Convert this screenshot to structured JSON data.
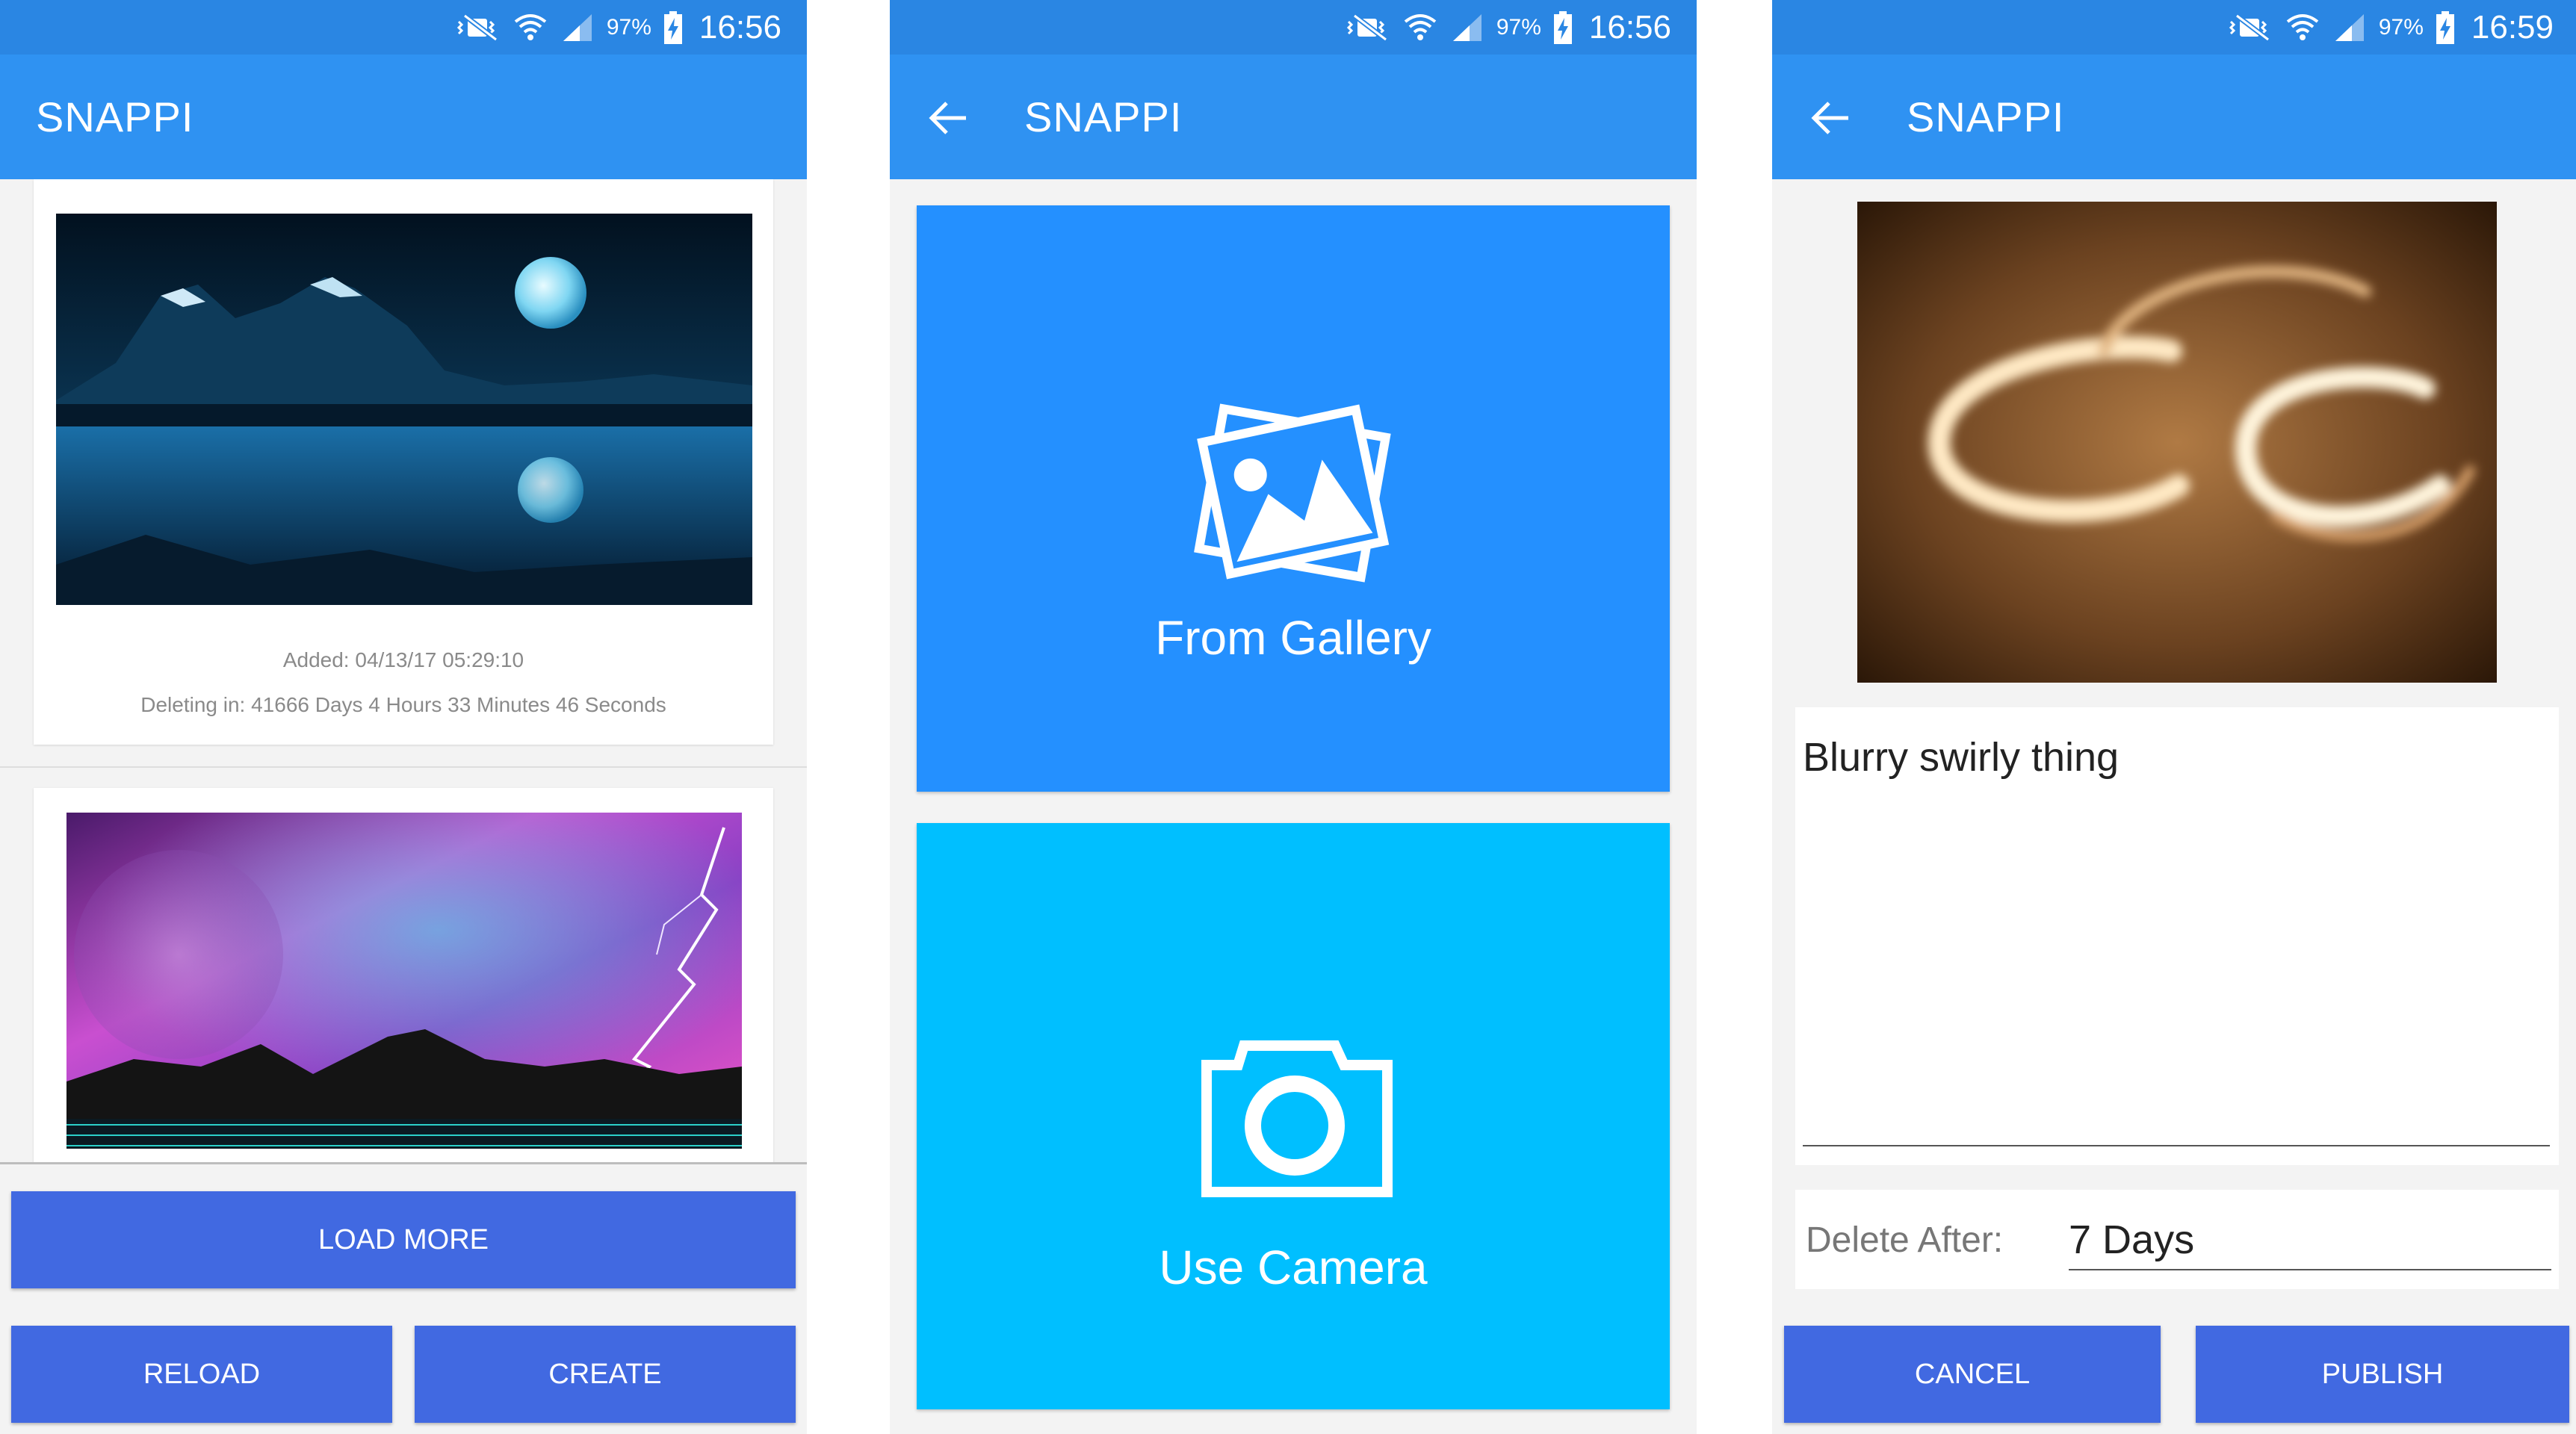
{
  "status_bar": [
    {
      "battery": "97%",
      "time": "16:56"
    },
    {
      "battery": "97%",
      "time": "16:56"
    },
    {
      "battery": "97%",
      "time": "16:59"
    }
  ],
  "app": {
    "title": "SNAPPI"
  },
  "feed": {
    "posts": [
      {
        "added": "Added: 04/13/17 05:29:10",
        "deleting": "Deleting in: 41666 Days 4 Hours 33 Minutes 46 Seconds"
      }
    ],
    "buttons": {
      "load_more": "LOAD MORE",
      "reload": "RELOAD",
      "create": "CREATE"
    }
  },
  "source_picker": {
    "gallery_label": "From Gallery",
    "camera_label": "Use Camera"
  },
  "compose": {
    "description": "Blurry swirly thing",
    "delete_after_label": "Delete After:",
    "delete_after_value": "7 Days",
    "buttons": {
      "cancel": "CANCEL",
      "publish": "PUBLISH"
    }
  },
  "colors": {
    "status_bar": "#2a86e3",
    "app_bar": "#2f92f2",
    "button": "#4169e1",
    "gallery_tile": "#2490ff",
    "camera_tile": "#00bfff",
    "background": "#f3f3f3"
  },
  "icons": [
    "mute-icon",
    "wifi-icon",
    "signal-icon",
    "battery-charging-icon",
    "back-arrow-icon",
    "gallery-icon",
    "camera-icon"
  ]
}
